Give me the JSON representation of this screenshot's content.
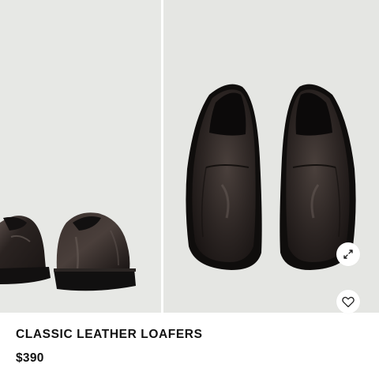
{
  "product": {
    "title": "CLASSIC LEATHER LOAFERS",
    "price": "$390"
  },
  "gallery": {
    "images": [
      {
        "name": "loafers-back-view"
      },
      {
        "name": "loafers-top-view"
      }
    ],
    "expand_icon": "expand-icon",
    "wishlist_icon": "heart-icon"
  },
  "colors": {
    "background": "#e6e7e4",
    "leather": "#2b2422",
    "sole": "#111111",
    "text": "#111111"
  }
}
